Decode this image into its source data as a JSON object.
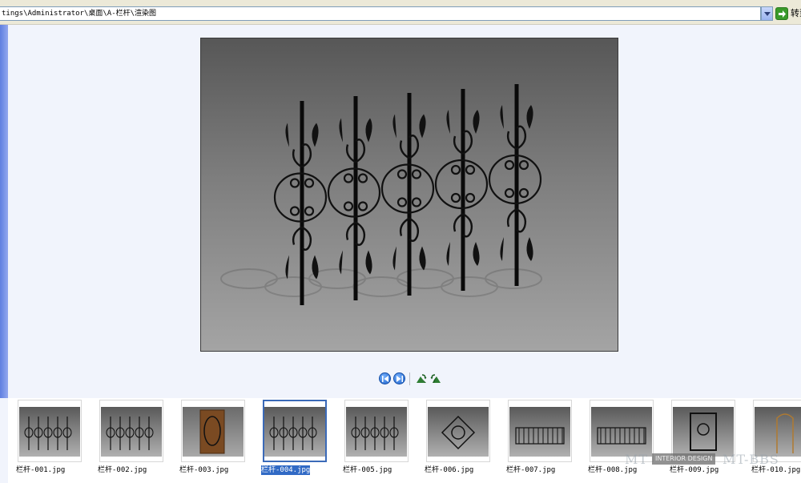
{
  "address_bar": {
    "path": "tings\\Administrator\\桌面\\A-栏杆\\渲染图",
    "go_label": "转到"
  },
  "nav_toolbar": {
    "buttons": [
      {
        "name": "previous-image",
        "icon": "prev-icon"
      },
      {
        "name": "next-image",
        "icon": "next-icon"
      },
      {
        "name": "rotate-clockwise",
        "icon": "rotate-cw-icon"
      },
      {
        "name": "rotate-counterclockwise",
        "icon": "rotate-ccw-icon"
      }
    ]
  },
  "filmstrip": {
    "selected_index": 3,
    "items": [
      {
        "filename": "栏杆-001.jpg"
      },
      {
        "filename": "栏杆-002.jpg"
      },
      {
        "filename": "栏杆-003.jpg"
      },
      {
        "filename": "栏杆-004.jpg"
      },
      {
        "filename": "栏杆-005.jpg"
      },
      {
        "filename": "栏杆-006.jpg"
      },
      {
        "filename": "栏杆-007.jpg"
      },
      {
        "filename": "栏杆-008.jpg"
      },
      {
        "filename": "栏杆-009.jpg"
      },
      {
        "filename": "栏杆-010.jpg"
      }
    ]
  },
  "watermark": {
    "left": "MT",
    "box": "INTERIOR DESIGN",
    "right": "MT-BBS"
  },
  "colors": {
    "selection": "#316ac5",
    "strip": "#5f7fe0",
    "go_button": "#3a9a2a"
  }
}
